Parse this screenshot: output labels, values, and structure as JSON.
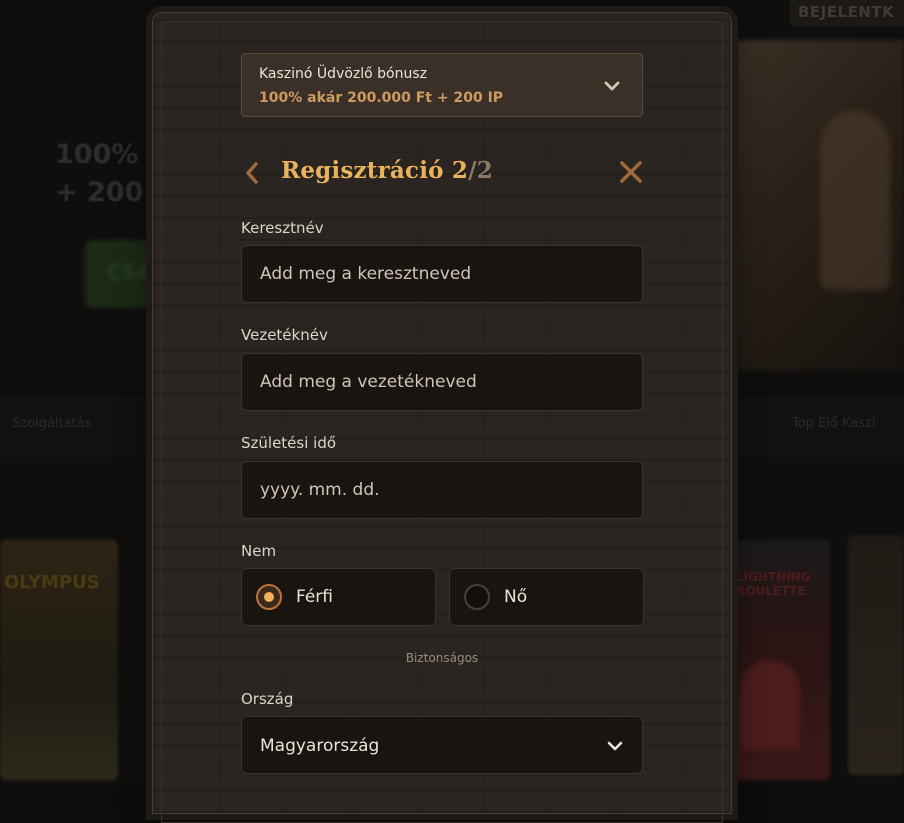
{
  "background": {
    "header_button": "BEJELENTK",
    "promo_line1": "100% a",
    "promo_line2": "+ 200",
    "green_button": "CSA",
    "strip_left": "Szolgáltatás",
    "strip_right": "Top Élő Kaszi",
    "card1_title": "OLYMPUS",
    "card2_title": "LIGHTNING ROULETTE"
  },
  "bonus": {
    "title": "Kaszinó Üdvözlő bónusz",
    "subtitle": "100% akár 200.000 Ft + 200 IP",
    "icon": "chevron-down-icon"
  },
  "header": {
    "title": "Regisztráció 2",
    "separator": "/",
    "total": "2",
    "back_icon": "chevron-left-icon",
    "close_icon": "close-icon"
  },
  "form": {
    "first_name": {
      "label": "Keresztnév",
      "placeholder": "Add meg a keresztneved",
      "value": ""
    },
    "last_name": {
      "label": "Vezetéknév",
      "placeholder": "Add meg a vezetékneved",
      "value": ""
    },
    "birth_date": {
      "label": "Születési idő",
      "placeholder": "yyyy. mm. dd.",
      "value": ""
    },
    "gender": {
      "label": "Nem",
      "options": [
        "Férfi",
        "Nő"
      ],
      "selected": "Férfi"
    },
    "secure_note": "Biztonságos",
    "country": {
      "label": "Ország",
      "value": "Magyarország"
    }
  },
  "colors": {
    "accent": "#ebb25e",
    "bonus_highlight": "#cf9a62",
    "field_bg": "#19140f",
    "modal_bg": "#2a2520"
  }
}
